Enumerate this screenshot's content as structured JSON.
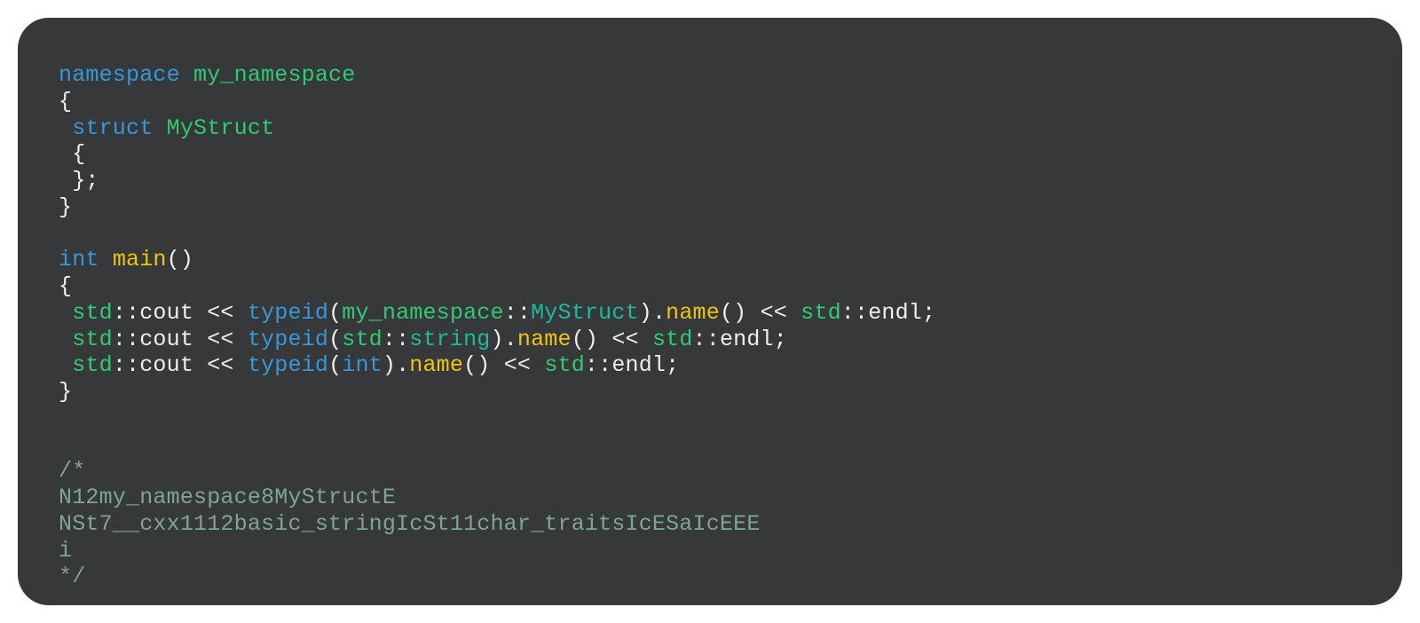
{
  "code": {
    "line1": {
      "namespace_kw": "namespace",
      "namespace_name": "my_namespace"
    },
    "line2": {
      "brace": "{"
    },
    "line3": {
      "indent": " ",
      "struct_kw": "struct",
      "struct_name": "MyStruct"
    },
    "line4": {
      "indent": " ",
      "brace": "{"
    },
    "line5": {
      "indent": " ",
      "brace": "};"
    },
    "line6": {
      "brace": "}"
    },
    "line8": {
      "type": "int",
      "fn": "main",
      "parens": "()"
    },
    "line9": {
      "brace": "{"
    },
    "line10": {
      "indent": " ",
      "std1": "std",
      "dcolon1": "::",
      "cout": "cout",
      "sp1": " ",
      "lshift1": "<<",
      "sp2": " ",
      "typeid": "typeid",
      "lparen": "(",
      "ns": "my_namespace",
      "dcolon2": "::",
      "type": "MyStruct",
      "rparen": ")",
      "dot": ".",
      "name": "name",
      "parens2": "()",
      "sp3": " ",
      "lshift2": "<<",
      "sp4": " ",
      "std2": "std",
      "dcolon3": "::",
      "endl": "endl",
      "semi": ";"
    },
    "line11": {
      "indent": " ",
      "std1": "std",
      "dcolon1": "::",
      "cout": "cout",
      "sp1": " ",
      "lshift1": "<<",
      "sp2": " ",
      "typeid": "typeid",
      "lparen": "(",
      "ns": "std",
      "dcolon2": "::",
      "type": "string",
      "rparen": ")",
      "dot": ".",
      "name": "name",
      "parens2": "()",
      "sp3": " ",
      "lshift2": "<<",
      "sp4": " ",
      "std2": "std",
      "dcolon3": "::",
      "endl": "endl",
      "semi": ";"
    },
    "line12": {
      "indent": " ",
      "std1": "std",
      "dcolon1": "::",
      "cout": "cout",
      "sp1": " ",
      "lshift1": "<<",
      "sp2": " ",
      "typeid": "typeid",
      "lparen": "(",
      "type": "int",
      "rparen": ")",
      "dot": ".",
      "name": "name",
      "parens2": "()",
      "sp3": " ",
      "lshift2": "<<",
      "sp4": " ",
      "std2": "std",
      "dcolon3": "::",
      "endl": "endl",
      "semi": ";"
    },
    "line13": {
      "brace": "}"
    },
    "comment": {
      "open": "/*",
      "l1": "N12my_namespace8MyStructE",
      "l2": "NSt7__cxx1112basic_stringIcSt11char_traitsIcESaIcEEE",
      "l3": "i",
      "close": "*/"
    }
  }
}
